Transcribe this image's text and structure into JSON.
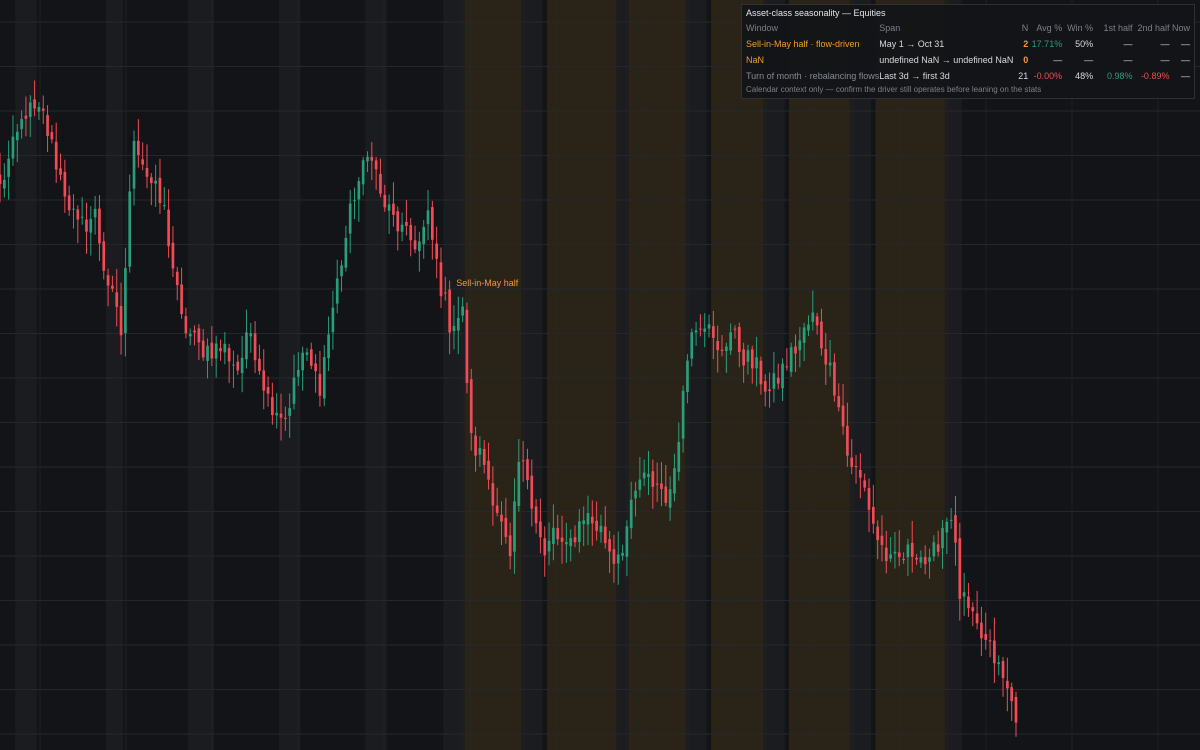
{
  "colors": {
    "background": "#131417",
    "grid": "#25272c",
    "up": "#26a07a",
    "down": "#ef4c58",
    "season_band": "#2a2418",
    "weekend_band": "#1c1d21",
    "accent": "#f59a2c"
  },
  "chart_data": {
    "type": "candlestick",
    "title": "",
    "xlabel": "",
    "ylabel": "",
    "bar_count": 236,
    "grid": true,
    "annotation": {
      "label": "Sell-in-May half",
      "start_bar": 106,
      "color": "#f59a2c"
    },
    "highlight_windows": [
      {
        "name": "Sell-in-May half",
        "bars": [
          107,
          121
        ]
      },
      {
        "name": "Sell-in-May half",
        "bars": [
          127,
          143
        ]
      },
      {
        "name": "Sell-in-May half",
        "bars": [
          145,
          159
        ]
      },
      {
        "name": "Sell-in-May half",
        "bars": [
          165,
          177
        ]
      },
      {
        "name": "Sell-in-May half",
        "bars": [
          183,
          197
        ]
      },
      {
        "name": "Sell-in-May half",
        "bars": [
          203,
          219
        ]
      }
    ],
    "turn_of_month_bars": [
      4,
      8,
      25,
      28,
      44,
      49,
      65,
      69,
      85,
      89,
      103,
      107,
      121,
      125,
      143,
      145,
      159,
      163,
      177,
      181,
      197,
      201,
      219,
      222
    ],
    "close_path": [
      [
        0,
        96.1
      ],
      [
        6,
        101.0
      ],
      [
        10,
        100.6
      ],
      [
        14,
        96.8
      ],
      [
        18,
        93.5
      ],
      [
        22,
        94.4
      ],
      [
        24,
        91.2
      ],
      [
        28,
        86.9
      ],
      [
        31,
        99.6
      ],
      [
        34,
        97.0
      ],
      [
        38,
        94.6
      ],
      [
        42,
        87.6
      ],
      [
        46,
        86.0
      ],
      [
        52,
        85.9
      ],
      [
        55,
        84.7
      ],
      [
        58,
        87.0
      ],
      [
        62,
        82.8
      ],
      [
        66,
        81.6
      ],
      [
        70,
        85.6
      ],
      [
        74,
        83.7
      ],
      [
        78,
        90.1
      ],
      [
        82,
        95.8
      ],
      [
        86,
        98.6
      ],
      [
        88,
        95.5
      ],
      [
        91,
        94.1
      ],
      [
        94,
        92.9
      ],
      [
        97,
        92.6
      ],
      [
        99,
        94.1
      ],
      [
        102,
        89.9
      ],
      [
        104,
        87.6
      ],
      [
        107,
        88.1
      ],
      [
        109,
        80.0
      ],
      [
        112,
        78.7
      ],
      [
        115,
        75.8
      ],
      [
        118,
        72.3
      ],
      [
        120,
        78.6
      ],
      [
        122,
        77.9
      ],
      [
        126,
        72.6
      ],
      [
        128,
        74.3
      ],
      [
        131,
        73.0
      ],
      [
        135,
        75.5
      ],
      [
        139,
        74.4
      ],
      [
        142,
        72.7
      ],
      [
        144,
        73.6
      ],
      [
        148,
        77.6
      ],
      [
        152,
        77.4
      ],
      [
        155,
        76.4
      ],
      [
        157,
        80.8
      ],
      [
        160,
        87.6
      ],
      [
        163,
        87.8
      ],
      [
        166,
        85.5
      ],
      [
        169,
        87.0
      ],
      [
        172,
        85.5
      ],
      [
        175,
        84.6
      ],
      [
        178,
        83.1
      ],
      [
        181,
        84.6
      ],
      [
        185,
        86.4
      ],
      [
        188,
        87.9
      ],
      [
        191,
        85.5
      ],
      [
        194,
        82.8
      ],
      [
        196,
        79.2
      ],
      [
        200,
        77.0
      ],
      [
        203,
        73.9
      ],
      [
        206,
        72.2
      ],
      [
        209,
        72.7
      ],
      [
        212,
        73.3
      ],
      [
        215,
        72.0
      ],
      [
        218,
        74.7
      ],
      [
        220,
        75.6
      ],
      [
        222,
        70.4
      ],
      [
        225,
        68.5
      ],
      [
        228,
        67.2
      ],
      [
        230,
        66.3
      ],
      [
        234,
        63.5
      ],
      [
        235,
        62.9
      ]
    ],
    "y_range": [
      60.5,
      108.0
    ]
  },
  "panel": {
    "title": "Asset-class seasonality — Equities",
    "headers": [
      "Window",
      "Span",
      "N",
      "Avg %",
      "Win %",
      "1st half",
      "2nd half",
      "Now"
    ],
    "rows": [
      {
        "window": "Sell-in-May half · flow-driven",
        "span": "May 1 → Oct 31",
        "n": "2",
        "avg": "17.71%",
        "win": "50%",
        "h1": "—",
        "h2": "—",
        "now": "—"
      },
      {
        "window": "NaN",
        "span": "undefined NaN → undefined NaN",
        "n": "0",
        "avg": "—",
        "win": "—",
        "h1": "—",
        "h2": "—",
        "now": "—"
      },
      {
        "window": "Turn of month · rebalancing flows",
        "span": "Last 3d → first 3d",
        "n": "21",
        "avg": "-0.00%",
        "win": "48%",
        "h1": "0.98%",
        "h2": "-0.89%",
        "now": "—"
      }
    ],
    "footnote": "Calendar context only — confirm the driver still operates before leaning on the stats"
  }
}
